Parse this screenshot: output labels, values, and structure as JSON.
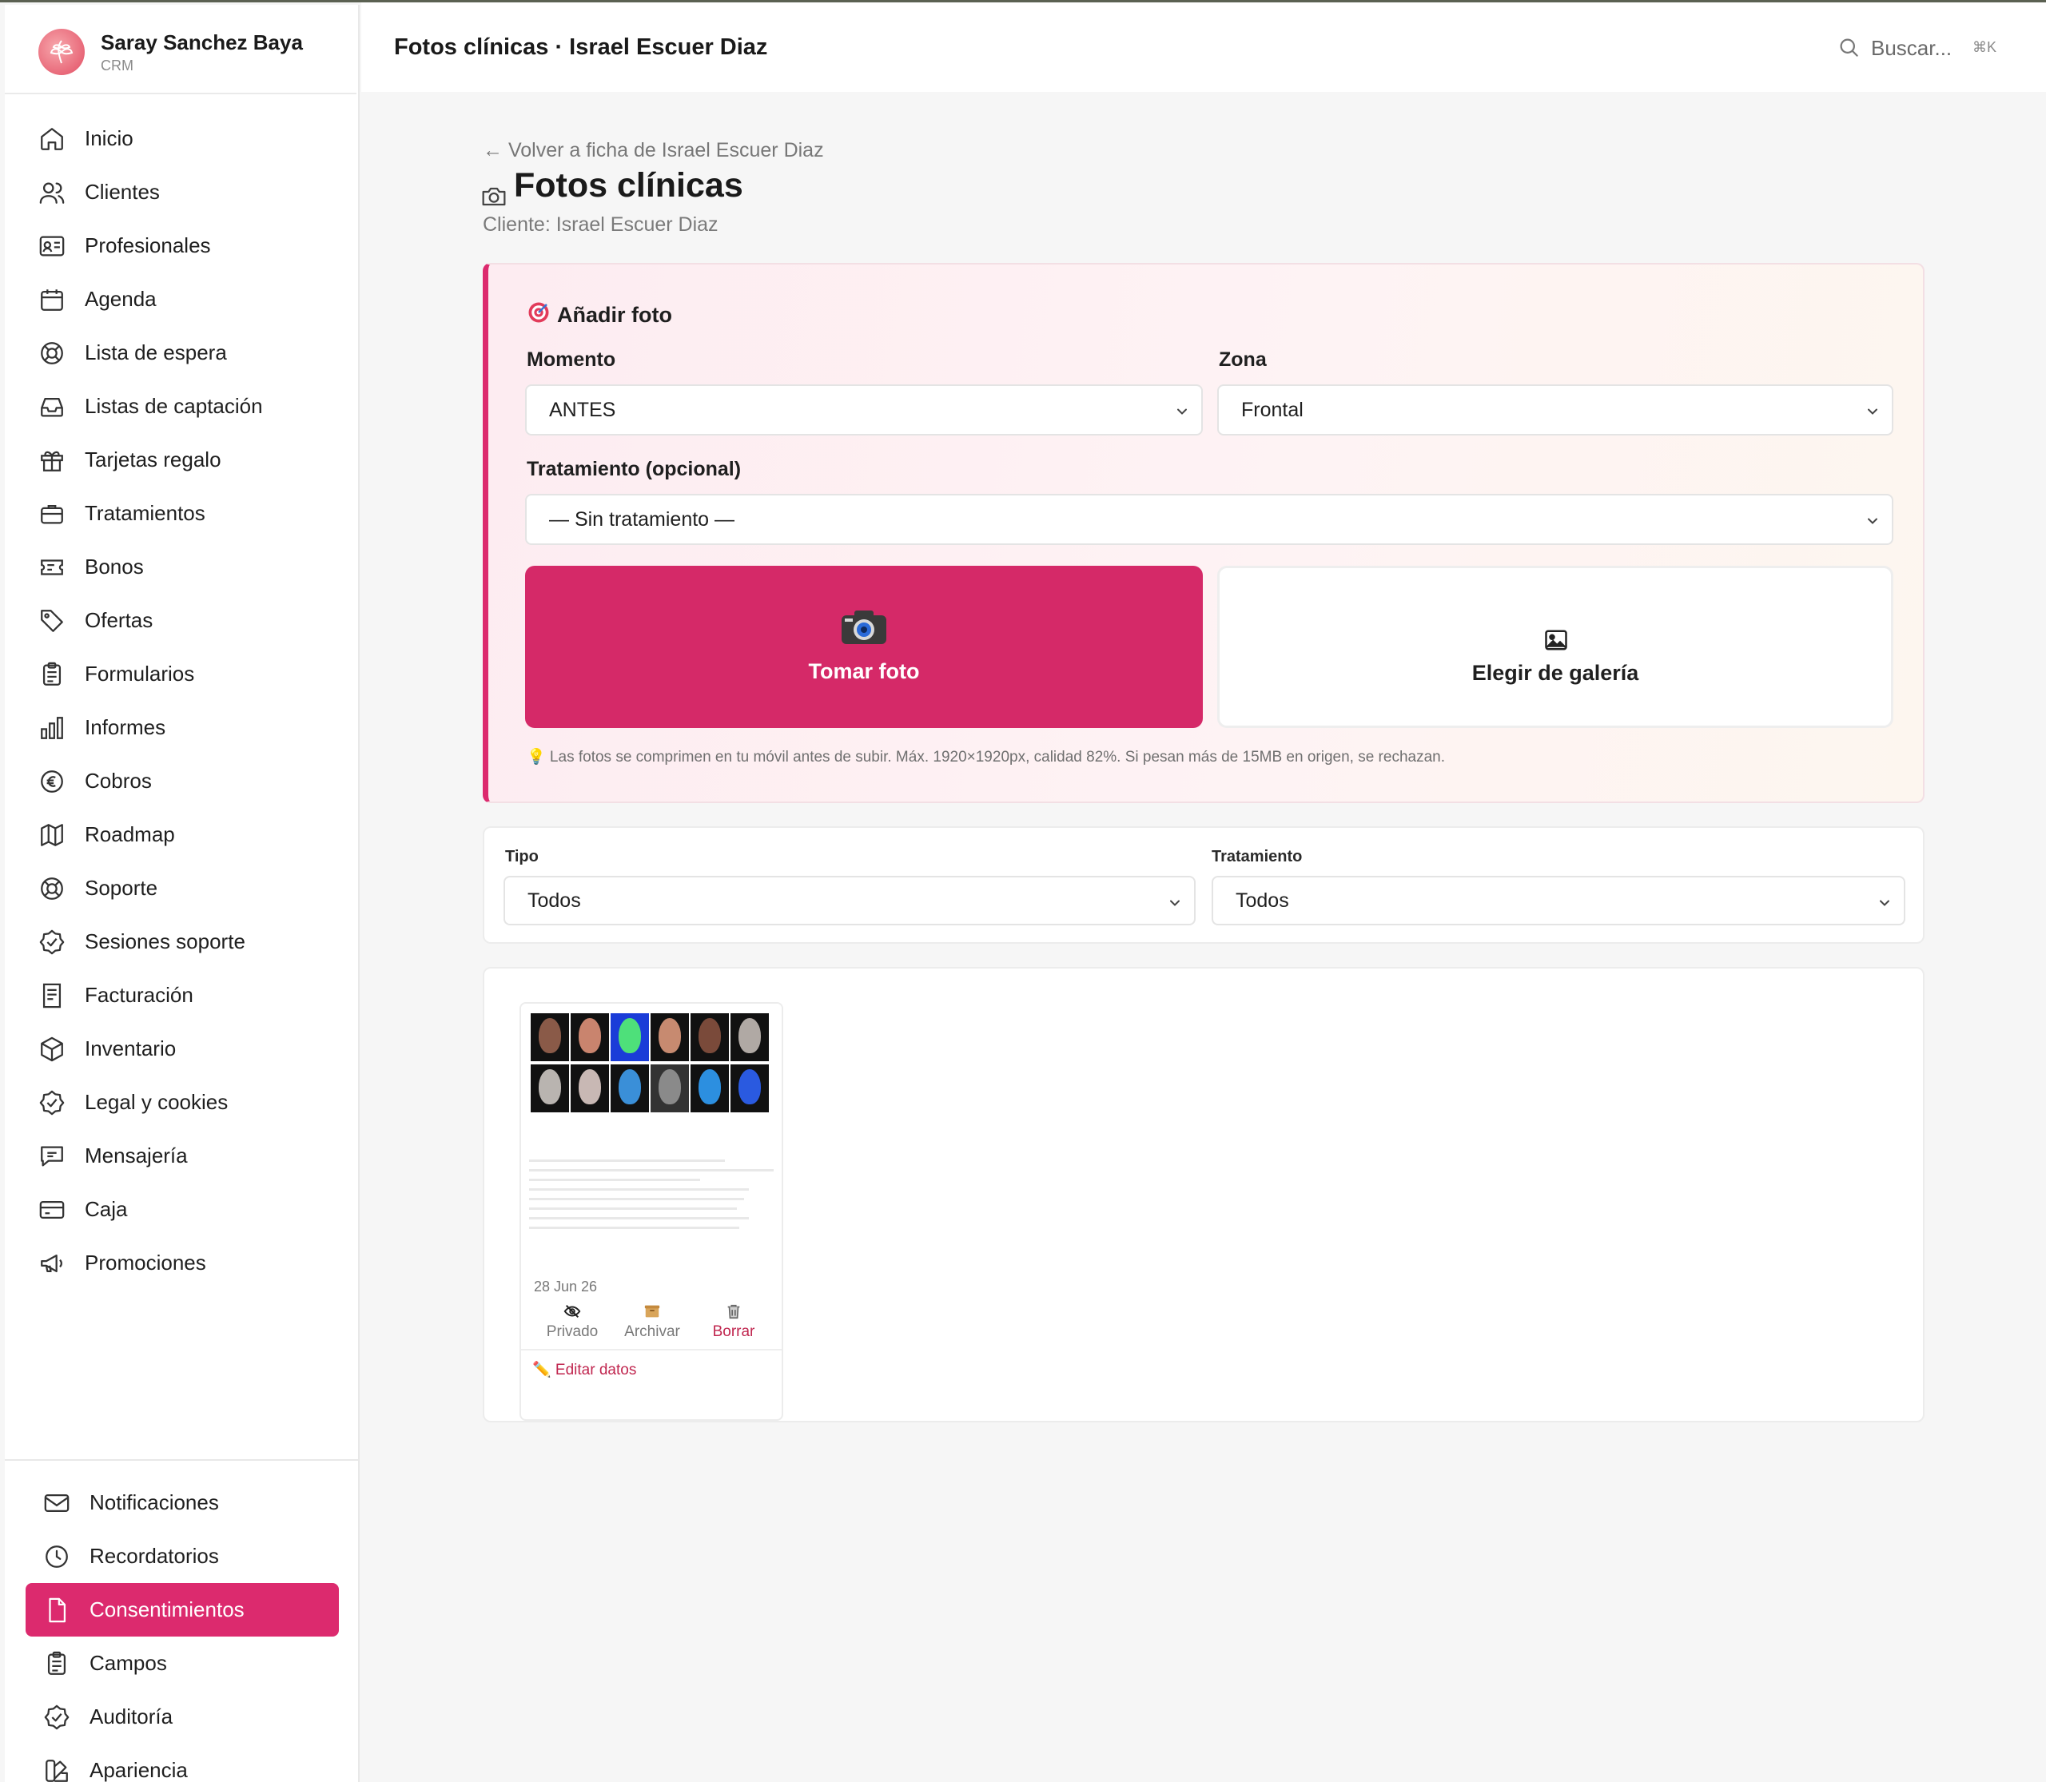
{
  "brand": {
    "name": "Saray Sanchez Baya",
    "sub": "CRM"
  },
  "sidebar": {
    "items": [
      {
        "label": "Inicio",
        "icon": "home-icon"
      },
      {
        "label": "Clientes",
        "icon": "users-icon"
      },
      {
        "label": "Profesionales",
        "icon": "id-card-icon"
      },
      {
        "label": "Agenda",
        "icon": "calendar-icon"
      },
      {
        "label": "Lista de espera",
        "icon": "lifebuoy-icon"
      },
      {
        "label": "Listas de captación",
        "icon": "inbox-icon"
      },
      {
        "label": "Tarjetas regalo",
        "icon": "gift-icon"
      },
      {
        "label": "Tratamientos",
        "icon": "briefcase-icon"
      },
      {
        "label": "Bonos",
        "icon": "ticket-icon"
      },
      {
        "label": "Ofertas",
        "icon": "tag-icon"
      },
      {
        "label": "Formularios",
        "icon": "clipboard-icon"
      },
      {
        "label": "Informes",
        "icon": "bar-chart-icon"
      },
      {
        "label": "Cobros",
        "icon": "euro-icon"
      },
      {
        "label": "Roadmap",
        "icon": "map-icon"
      },
      {
        "label": "Soporte",
        "icon": "lifebuoy-icon"
      },
      {
        "label": "Sesiones soporte",
        "icon": "check-badge-icon"
      },
      {
        "label": "Facturación",
        "icon": "receipt-icon"
      },
      {
        "label": "Inventario",
        "icon": "box-icon"
      },
      {
        "label": "Legal y cookies",
        "icon": "shield-check-icon"
      },
      {
        "label": "Mensajería",
        "icon": "chat-icon"
      },
      {
        "label": "Caja",
        "icon": "card-icon"
      },
      {
        "label": "Promociones",
        "icon": "megaphone-icon"
      }
    ],
    "bottom_items": [
      {
        "label": "Notificaciones",
        "icon": "mail-icon"
      },
      {
        "label": "Recordatorios",
        "icon": "clock-icon"
      },
      {
        "label": "Consentimientos",
        "icon": "file-icon",
        "active": true
      },
      {
        "label": "Campos",
        "icon": "clipboard-icon"
      },
      {
        "label": "Auditoría",
        "icon": "check-badge-icon"
      },
      {
        "label": "Apariencia",
        "icon": "palette-icon"
      }
    ]
  },
  "header": {
    "title": "Fotos clínicas · Israel Escuer Diaz",
    "search_placeholder": "Buscar...",
    "search_shortcut": "⌘K"
  },
  "main": {
    "back_link": "← Volver a ficha de Israel Escuer Diaz",
    "title": "Fotos clínicas",
    "subtitle": "Cliente: Israel Escuer Diaz"
  },
  "add_photo": {
    "title": "Añadir foto",
    "momento_label": "Momento",
    "momento_value": "ANTES",
    "zona_label": "Zona",
    "zona_value": "Frontal",
    "tratamiento_label": "Tratamiento (opcional)",
    "tratamiento_value": "— Sin tratamiento —",
    "take_photo": "Tomar foto",
    "gallery": "Elegir de galería",
    "hint": "💡 Las fotos se comprimen en tu móvil antes de subir. Máx. 1920×1920px, calidad 82%. Si pesan más de 15MB en origen, se rechazan."
  },
  "filters": {
    "tipo_label": "Tipo",
    "tipo_value": "Todos",
    "tratamiento_label": "Tratamiento",
    "tratamiento_value": "Todos"
  },
  "photos": [
    {
      "date": "28 Jun 26",
      "actions": {
        "private": "Privado",
        "archive": "Archivar",
        "delete": "Borrar"
      },
      "edit": "✏️ Editar datos"
    }
  ],
  "colors": {
    "accent": "#dc2a6e",
    "danger": "#c0264f"
  }
}
